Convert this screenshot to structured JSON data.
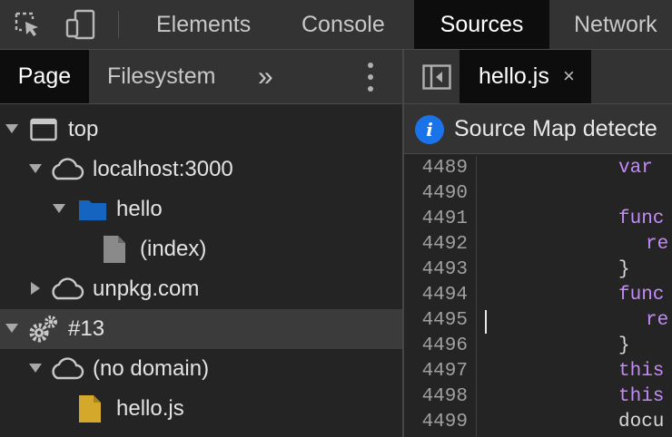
{
  "toolbar": {
    "tabs": [
      {
        "label": "Elements"
      },
      {
        "label": "Console"
      },
      {
        "label": "Sources",
        "active": true
      },
      {
        "label": "Network"
      }
    ],
    "icons": [
      "inspect-element-icon",
      "device-toolbar-icon"
    ]
  },
  "navigator": {
    "tabs": [
      {
        "label": "Page",
        "active": true
      },
      {
        "label": "Filesystem"
      }
    ],
    "more_tabs_label": "»",
    "tree": [
      {
        "label": "top",
        "icon": "frame-icon",
        "expanded": true
      },
      {
        "label": "localhost:3000",
        "icon": "cloud-icon",
        "expanded": true
      },
      {
        "label": "hello",
        "icon": "folder-icon",
        "expanded": true
      },
      {
        "label": "(index)",
        "icon": "file-icon"
      },
      {
        "label": "unpkg.com",
        "icon": "cloud-icon",
        "expanded": false
      },
      {
        "label": "#13",
        "icon": "gear-icon",
        "expanded": true,
        "selected": true
      },
      {
        "label": "(no domain)",
        "icon": "cloud-icon",
        "expanded": true
      },
      {
        "label": "hello.js",
        "icon": "js-file-icon"
      }
    ]
  },
  "editor": {
    "tab": {
      "label": "hello.js",
      "close": "×"
    },
    "infobar": {
      "text": "Source Map detecte"
    },
    "lines": [
      {
        "num": "4489",
        "text": "var ",
        "kind": "kw"
      },
      {
        "num": "4490",
        "text": "",
        "kind": "plain"
      },
      {
        "num": "4491",
        "text": "func",
        "kind": "kw"
      },
      {
        "num": "4492",
        "text": "re",
        "kind": "kw"
      },
      {
        "num": "4493",
        "text": "}",
        "kind": "plain"
      },
      {
        "num": "4494",
        "text": "func",
        "kind": "kw"
      },
      {
        "num": "4495",
        "text": "re",
        "kind": "kw"
      },
      {
        "num": "4496",
        "text": "}",
        "kind": "plain"
      },
      {
        "num": "4497",
        "text": "this",
        "kind": "kw"
      },
      {
        "num": "4498",
        "text": "this",
        "kind": "kw"
      },
      {
        "num": "4499",
        "text": "docu",
        "kind": "plain"
      }
    ]
  },
  "colors": {
    "keyword": "#c58af9",
    "info_blue": "#1a73e8",
    "folder_blue": "#1565c0",
    "js_file_yellow": "#d4a82a"
  }
}
